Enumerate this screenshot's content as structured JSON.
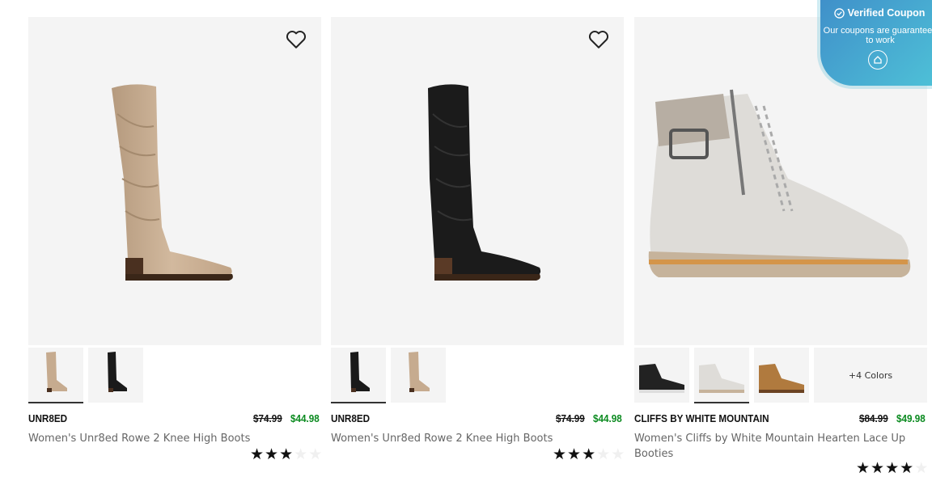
{
  "products": [
    {
      "brand": "UNR8ED",
      "old_price": "$74.99",
      "sale_price": "$44.98",
      "title": "Women's Unr8ed Rowe 2 Knee High Boots",
      "rating": 3,
      "colors": [
        "taupe",
        "black"
      ]
    },
    {
      "brand": "UNR8ED",
      "old_price": "$74.99",
      "sale_price": "$44.98",
      "title": "Women's Unr8ed Rowe 2 Knee High Boots",
      "rating": 3,
      "colors": [
        "black",
        "taupe"
      ]
    },
    {
      "brand": "CLIFFS BY WHITE MOUNTAIN",
      "old_price": "$84.99",
      "sale_price": "$49.98",
      "title": "Women's Cliffs by White Mountain Hearten Lace Up Booties",
      "rating": 4,
      "colors": [
        "black",
        "white",
        "tan"
      ],
      "more_colors": "+4 Colors"
    }
  ],
  "coupon_badge": {
    "title": "Verified Coupon",
    "subtitle": "Our coupons are guaranteed to work"
  },
  "icons": {
    "favorite": "heart-icon",
    "verified": "check-circle-icon",
    "coupon": "coupon-logo-icon"
  },
  "colors": {
    "sale_price": "#0a8a1f",
    "card_bg": "#f4f4f4",
    "coupon_gradient_start": "#3f8ec9",
    "coupon_gradient_end": "#4fc4d8"
  }
}
